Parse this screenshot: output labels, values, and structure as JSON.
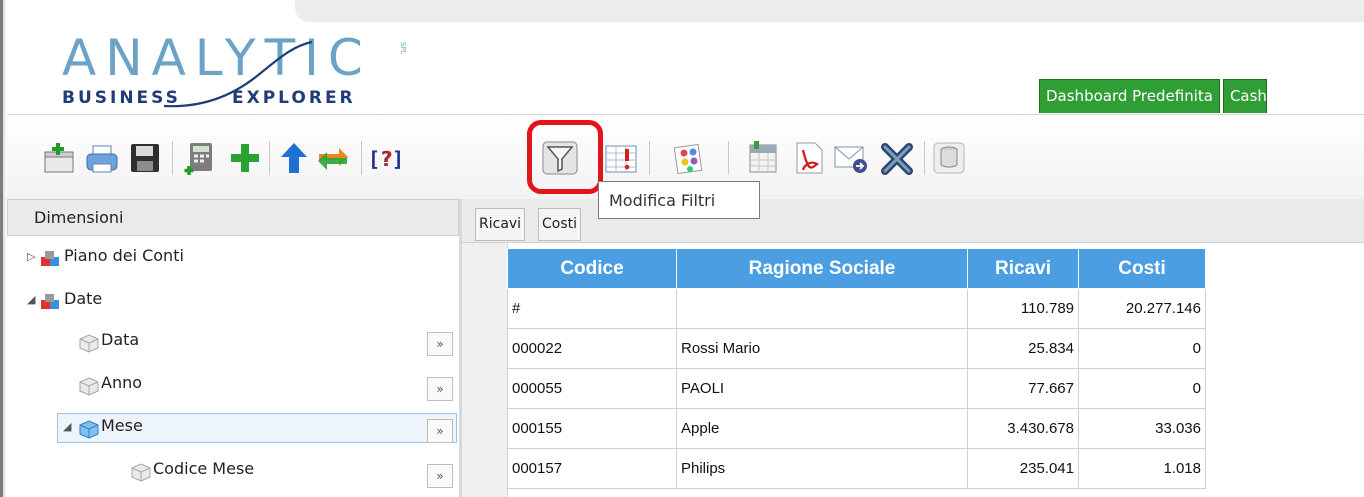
{
  "logo": {
    "word1": "ANALYTIC",
    "word2": "BUSINESS",
    "word3": "EXPLORER",
    "badge": "SPL"
  },
  "tabs": [
    "Dashboard Predefinita",
    "Cash"
  ],
  "toolbar": {
    "icons": [
      "new-icon",
      "print-icon",
      "save-icon",
      "calculator-icon",
      "add-icon",
      "move-up-icon",
      "swap-icon",
      "query-icon",
      "filter-icon",
      "table-alert-icon",
      "chart-palette-icon",
      "calendar-icon",
      "pdf-icon",
      "email-icon",
      "delete-icon",
      "database-icon"
    ],
    "tooltip": "Modifica Filtri"
  },
  "left_panel": {
    "title": "Dimensioni",
    "nodes": [
      {
        "label": "Piano dei Conti"
      },
      {
        "label": "Date"
      },
      {
        "label": "Data",
        "expand": "»"
      },
      {
        "label": "Anno",
        "expand": "»"
      },
      {
        "label": "Mese",
        "expand": "»"
      },
      {
        "label": "Codice Mese",
        "expand": "»"
      }
    ]
  },
  "measures": [
    "Ricavi",
    "Costi"
  ],
  "grid": {
    "columns": [
      "Codice",
      "Ragione Sociale",
      "Ricavi",
      "Costi"
    ],
    "rows": [
      [
        "#",
        "",
        "110.789",
        "20.277.146"
      ],
      [
        "000022",
        "Rossi Mario",
        "25.834",
        "0"
      ],
      [
        "000055",
        "PAOLI",
        "77.667",
        "0"
      ],
      [
        "000155",
        "Apple",
        "3.430.678",
        "33.036"
      ],
      [
        "000157",
        "Philips",
        "235.041",
        "1.018"
      ]
    ]
  },
  "colors": {
    "tab_green": "#2f9e35",
    "grid_header_blue": "#4a9ee1",
    "highlight_red": "#e1151b",
    "logo_light_blue": "#6ba3c7",
    "logo_navy": "#1f3d78"
  }
}
